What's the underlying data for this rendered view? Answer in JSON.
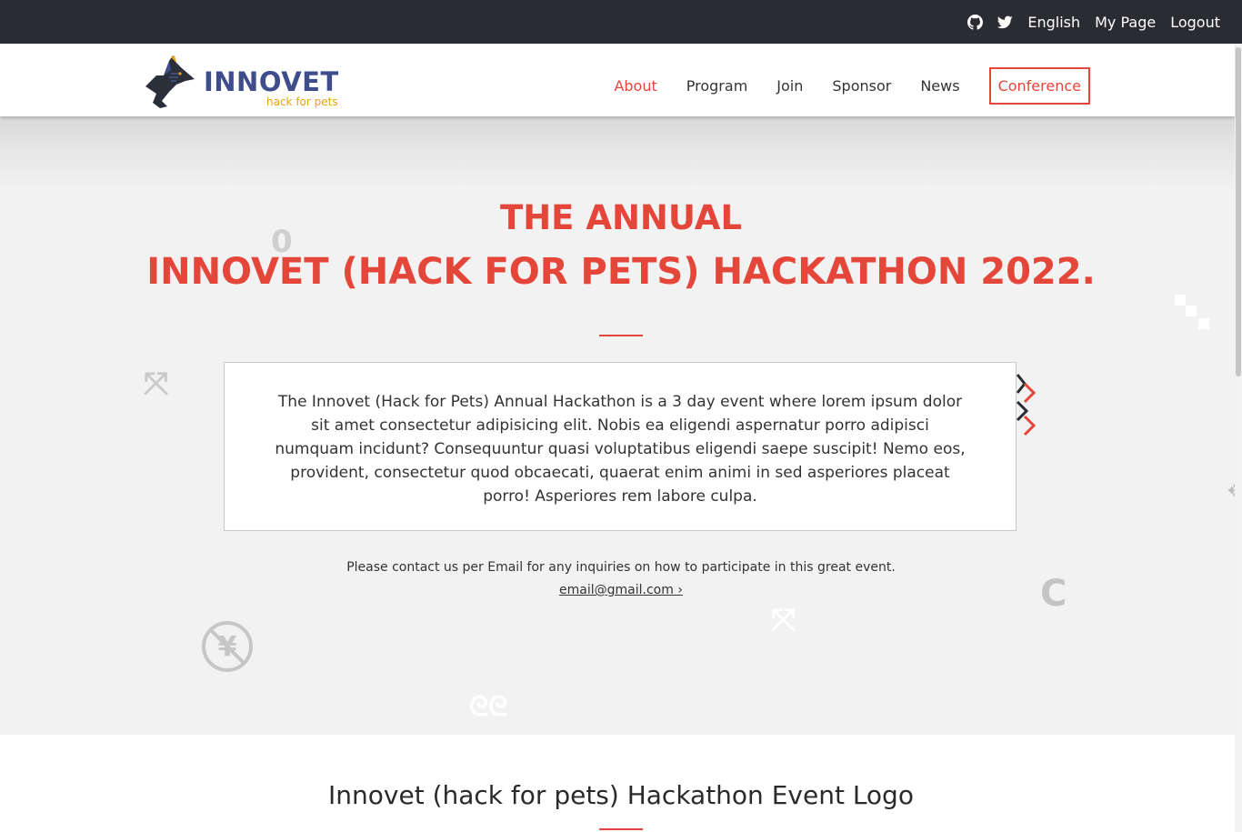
{
  "topbar": {
    "icons": [
      "github-icon",
      "twitter-icon"
    ],
    "language": "English",
    "mypage": "My Page",
    "logout": "Logout"
  },
  "logo": {
    "title": "INNOVET",
    "tagline": "hack for pets"
  },
  "nav": {
    "items": [
      "About",
      "Program",
      "Join",
      "Sponsor",
      "News"
    ],
    "active": "About",
    "conference": "Conference"
  },
  "hero": {
    "title_line1": "THE ANNUAL",
    "title_line2": "INNOVET (HACK FOR PETS) HACKATHON 2022.",
    "description": "The Innovet (Hack for Pets) Annual Hackathon is a 3 day event where lorem ipsum dolor sit amet consectetur adipisicing elit. Nobis ea eligendi aspernatur porro adipisci numquam incidunt? Consequuntur quasi voluptatibus eligendi saepe suscipit! Nemo eos, provident, consectetur quod obcaecati, quaerat enim animi in sed asperiores placeat porro! Asperiores rem labore culpa.",
    "contact_text": "Please contact us per Email for any inquiries on how to participate in this great event.",
    "contact_email": "email@gmail.com ›"
  },
  "section2": {
    "title": "Innovet (hack for pets) Hackathon Event Logo"
  },
  "colors": {
    "accent": "#e5463a",
    "topbar": "#2a2c31",
    "logo_blue": "#3f4d8c",
    "logo_orange": "#e8a20c"
  }
}
